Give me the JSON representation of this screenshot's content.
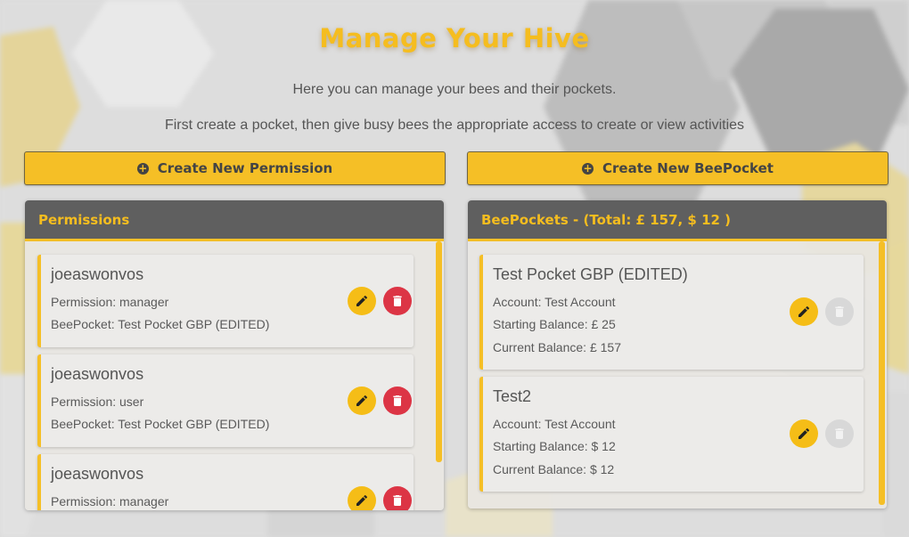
{
  "page": {
    "title": "Manage Your Hive",
    "subtitle_1": "Here you can manage your bees and their pockets.",
    "subtitle_2": "First create a pocket, then give busy bees the appropriate access to create or view activities"
  },
  "actions": {
    "create_permission_label": "Create New Permission",
    "create_beepocket_label": "Create New BeePocket"
  },
  "permissions_panel": {
    "title": "Permissions",
    "items": [
      {
        "name": "joeaswonvos",
        "permission": "Permission: manager",
        "beepocket": "BeePocket: Test Pocket GBP (EDITED)"
      },
      {
        "name": "joeaswonvos",
        "permission": "Permission: user",
        "beepocket": "BeePocket: Test Pocket GBP (EDITED)"
      },
      {
        "name": "joeaswonvos",
        "permission": "Permission: manager",
        "beepocket": ""
      }
    ]
  },
  "beepockets_panel": {
    "title": "BeePockets - (Total: £ 157, $ 12 )",
    "items": [
      {
        "name": "Test Pocket GBP (EDITED)",
        "account": "Account: Test Account",
        "starting": "Starting Balance: £ 25",
        "current": "Current Balance: £ 157"
      },
      {
        "name": "Test2",
        "account": "Account: Test Account",
        "starting": "Starting Balance: $ 12",
        "current": "Current Balance: $ 12"
      }
    ]
  },
  "icons": {
    "create": "plus-circle-icon",
    "edit": "pencil-icon",
    "delete": "trash-icon"
  },
  "colors": {
    "accent": "#f5bf26",
    "header_bg": "#5f5f5f",
    "delete": "#dc3545",
    "disabled": "#d8d8d8"
  }
}
